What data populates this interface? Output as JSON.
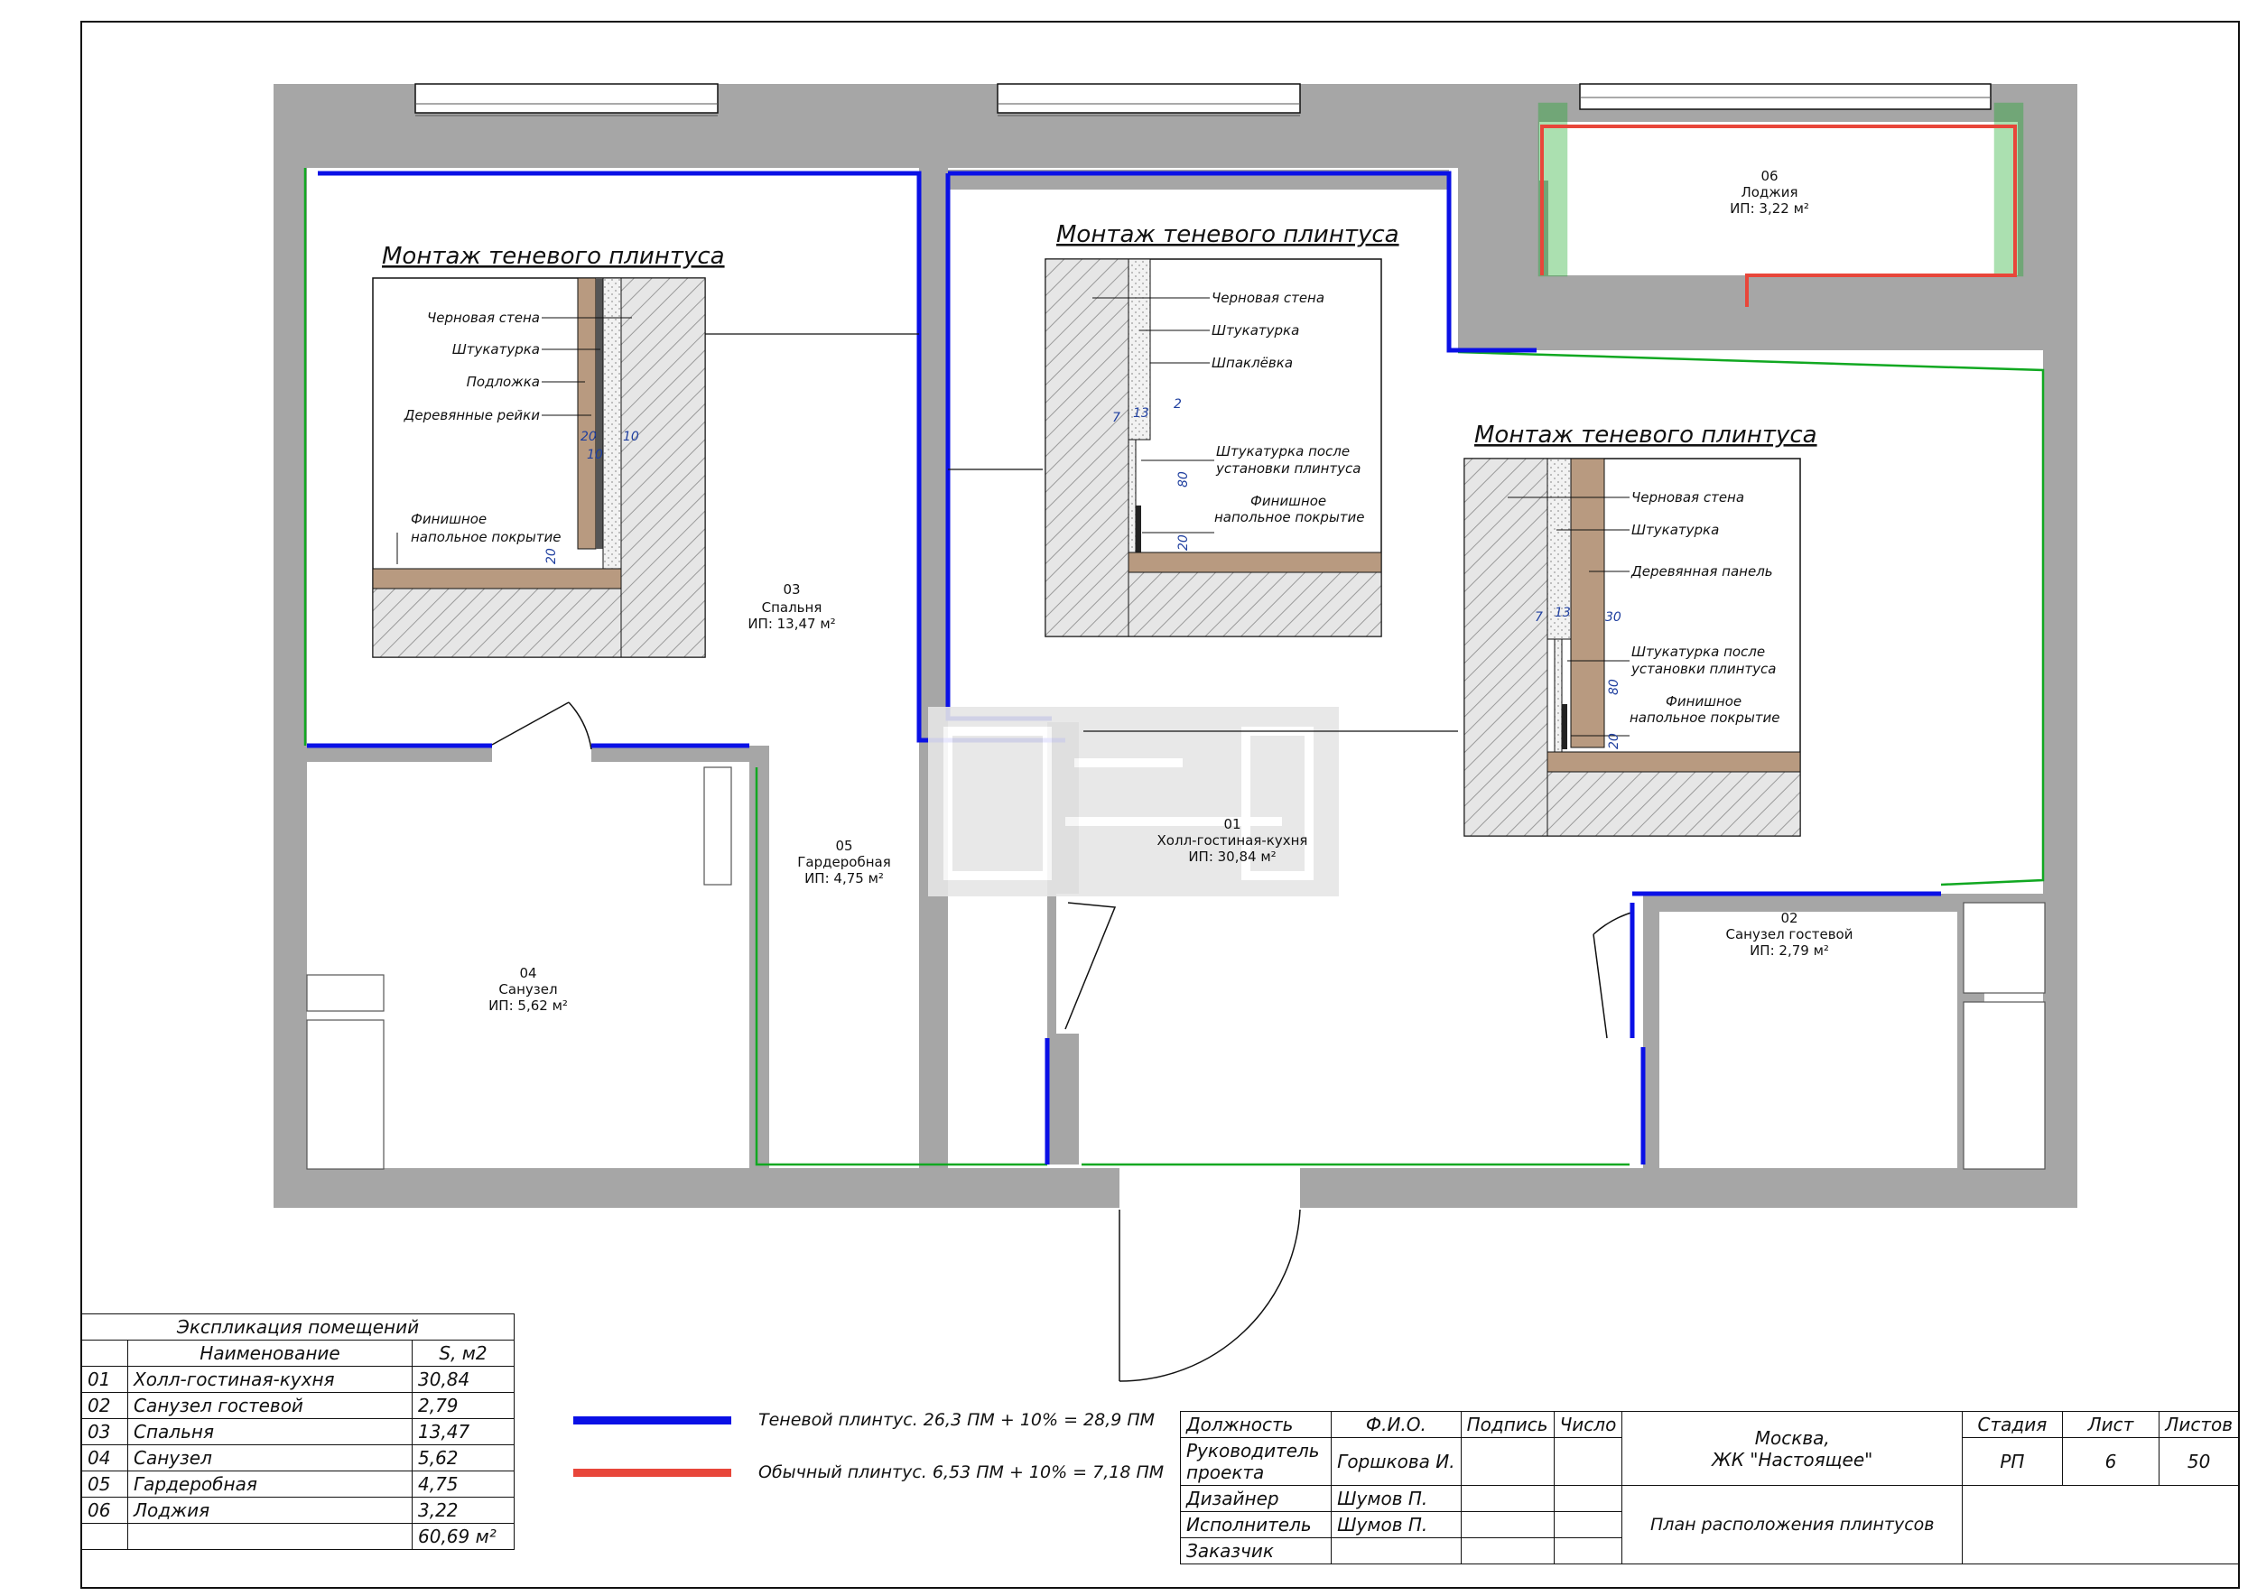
{
  "colors": {
    "shadow_plinth": "#0a10e6",
    "regular_plinth": "#e8463a",
    "wall_fill": "#a6a6a6",
    "green_line": "#11a821"
  },
  "rooms": [
    {
      "id": "01",
      "name": "Холл-гостиная-кухня",
      "area": "ИП: 30,84 м²"
    },
    {
      "id": "02",
      "name": "Санузел гостевой",
      "area": "ИП: 2,79 м²"
    },
    {
      "id": "03",
      "name": "Спальня",
      "area": "ИП: 13,47 м²"
    },
    {
      "id": "04",
      "name": "Санузел",
      "area": "ИП: 5,62 м²"
    },
    {
      "id": "05",
      "name": "Гардеробная",
      "area": "ИП: 4,75 м²"
    },
    {
      "id": "06",
      "name": "Лоджия",
      "area": "ИП: 3,22 м²"
    }
  ],
  "details": [
    {
      "title": "Монтаж теневого плинтуса",
      "labels": [
        "Черновая стена",
        "Штукатурка",
        "Подложка",
        "Деревянные рейки",
        "Финишное",
        "напольное покрытие"
      ],
      "dims": [
        "20",
        "10",
        "10",
        "20"
      ]
    },
    {
      "title": "Монтаж теневого плинтуса",
      "labels": [
        "Черновая стена",
        "Штукатурка",
        "Шпаклёвка",
        "Штукатурка после",
        "установки плинтуса",
        "Финишное",
        "напольное покрытие"
      ],
      "dims": [
        "7",
        "13",
        "2",
        "80",
        "20"
      ]
    },
    {
      "title": "Монтаж теневого плинтуса",
      "labels": [
        "Черновая стена",
        "Штукатурка",
        "Деревянная панель",
        "Штукатурка после",
        "установки плинтуса",
        "Финишное",
        "напольное покрытие"
      ],
      "dims": [
        "7",
        "13",
        "30",
        "80",
        "20"
      ]
    }
  ],
  "explication": {
    "title": "Экспликация помещений",
    "col_name": "Наименование",
    "col_area": "S, м2",
    "rows": [
      {
        "num": "01",
        "name": "Холл-гостиная-кухня",
        "area": "30,84"
      },
      {
        "num": "02",
        "name": "Санузел гостевой",
        "area": "2,79"
      },
      {
        "num": "03",
        "name": "Спальня",
        "area": "13,47"
      },
      {
        "num": "04",
        "name": "Санузел",
        "area": "5,62"
      },
      {
        "num": "05",
        "name": "Гардеробная",
        "area": "4,75"
      },
      {
        "num": "06",
        "name": "Лоджия",
        "area": "3,22"
      }
    ],
    "total": "60,69 м²"
  },
  "legend": {
    "shadow": "Теневой плинтус. 26,3 ПМ + 10% = 28,9 ПМ",
    "regular": "Обычный плинтус. 6,53 ПМ + 10% = 7,18 ПМ"
  },
  "title_block": {
    "h_position": "Должность",
    "h_fio": "Ф.И.О.",
    "h_sign": "Подпись",
    "h_date": "Число",
    "r1_pos_a": "Руководитель",
    "r1_pos_b": "проекта",
    "r1_name": "Горшкова И.",
    "r2_pos": "Дизайнер",
    "r2_name": "Шумов П.",
    "r3_pos": "Исполнитель",
    "r3_name": "Шумов П.",
    "r4_pos": "Заказчик",
    "location_a": "Москва,",
    "location_b": "ЖК \"Настоящее\"",
    "sheet_title": "План расположения плинтусов",
    "h_stage": "Стадия",
    "h_sheet": "Лист",
    "h_sheets": "Листов",
    "stage": "РП",
    "sheet": "6",
    "sheets": "50"
  }
}
